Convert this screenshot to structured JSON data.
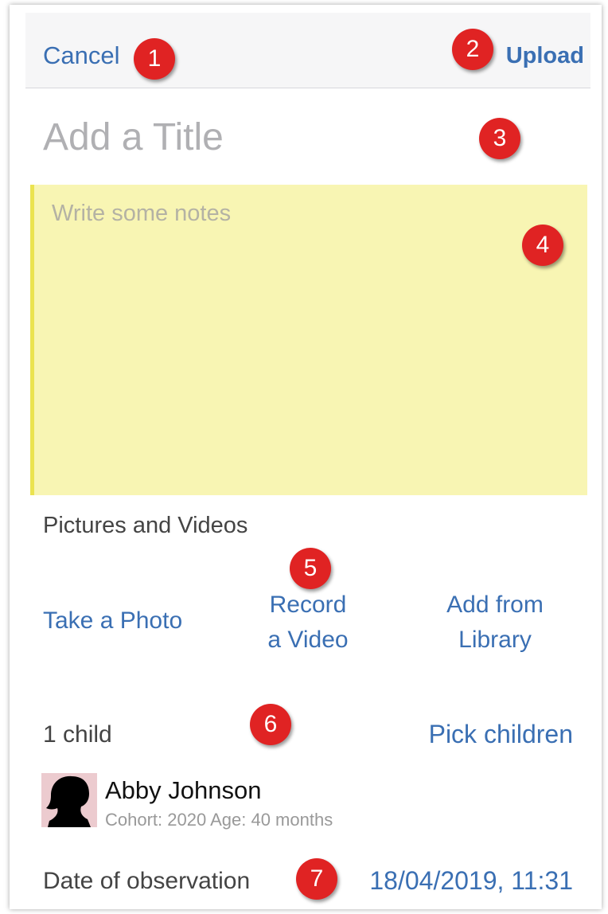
{
  "navbar": {
    "cancel_label": "Cancel",
    "upload_label": "Upload"
  },
  "title": {
    "placeholder": "Add a Title",
    "value": ""
  },
  "notes": {
    "placeholder": "Write some notes",
    "value": ""
  },
  "media": {
    "section_label": "Pictures and Videos",
    "take_photo": "Take a Photo",
    "record_video_line1": "Record",
    "record_video_line2": "a Video",
    "add_library_line1": "Add from",
    "add_library_line2": "Library"
  },
  "children": {
    "count_label": "1 child",
    "pick_label": "Pick children",
    "items": [
      {
        "name": "Abby Johnson",
        "meta": "Cohort: 2020 Age: 40 months",
        "avatar_icon": "child-silhouette-icon"
      }
    ]
  },
  "observation": {
    "date_label": "Date of observation",
    "date_value": "18/04/2019, 11:31"
  },
  "annotations": [
    "1",
    "2",
    "3",
    "4",
    "5",
    "6",
    "7"
  ],
  "colors": {
    "link": "#3a6fb3",
    "notes_bg": "#f8f5b3",
    "notes_border": "#ebe34f",
    "badge": "#e02323"
  }
}
